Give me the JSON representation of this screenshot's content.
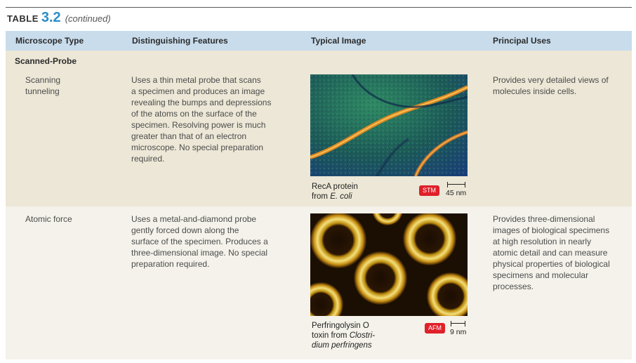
{
  "table": {
    "label_word": "TABLE",
    "label_number": "3.2",
    "label_note": "(continued)"
  },
  "headers": {
    "col1": "Microscope Type",
    "col2": "Distinguishing Features",
    "col3": "Typical Image",
    "col4": "Principal Uses"
  },
  "section": {
    "label": "Scanned-Probe"
  },
  "rows": [
    {
      "type_lines": [
        "Scanning",
        "tunneling"
      ],
      "features_lines": [
        "Uses a thin metal probe that scans",
        "a specimen and produces an image",
        "revealing the bumps and depressions",
        "of the atoms on the surface of the",
        "specimen. Resolving power is much",
        "greater than that of an electron",
        "microscope. No special preparation",
        "required."
      ],
      "uses_lines": [
        "Provides very detailed views of",
        "molecules inside cells."
      ],
      "caption_line1": "RecA protein",
      "caption_line2_prefix": "from ",
      "caption_line2_italic": "E. coli",
      "badge": "STM",
      "scale": "45 nm"
    },
    {
      "type_lines": [
        "Atomic force"
      ],
      "features_lines": [
        "Uses a metal-and-diamond probe",
        "gently forced down along the",
        "surface of the specimen. Produces a",
        "three-dimensional image. No special",
        "preparation required."
      ],
      "uses_lines": [
        "Provides three-dimensional",
        "images of biological specimens",
        "at high resolution in nearly",
        "atomic detail and can measure",
        "physical properties of biological",
        "specimens and molecular",
        "processes."
      ],
      "caption_line1": "Perfringolysin O",
      "caption_line2_prefix": "toxin from ",
      "caption_line2_italic": "Clostri-",
      "caption_line3_italic": "dium perfringens",
      "badge": "AFM",
      "scale": "9 nm"
    }
  ],
  "colors": {
    "header_bg": "#c8dcec",
    "row_bg_1": "#ece7d6",
    "row_bg_2": "#f4f2ea",
    "accent_number": "#2a8ec9",
    "badge_red": "#e0202a"
  }
}
